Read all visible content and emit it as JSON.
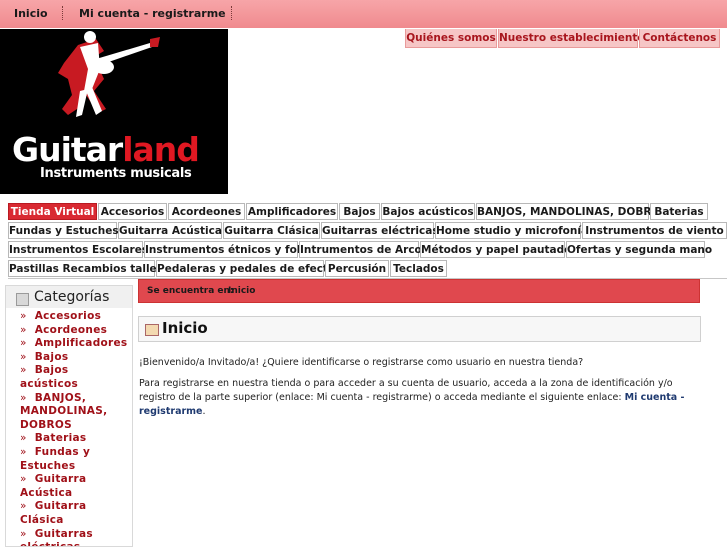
{
  "topnav": {
    "home": "Inicio",
    "account": "Mi cuenta - registrarme"
  },
  "toplinks": [
    "Quiénes somos",
    "Nuestro establecimiento",
    "Contáctenos"
  ],
  "logo": {
    "brand_a": "Guitar",
    "brand_b": "land",
    "tagline": "Instruments musicals"
  },
  "tabs": [
    "Tienda Virtual",
    "Accesorios",
    "Acordeones",
    "Amplificadores",
    "Bajos",
    "Bajos acústicos",
    "BANJOS, MANDOLINAS, DOBROS",
    "Baterias",
    "Fundas y Estuches",
    "Guitarra Acústica",
    "Guitarra Clásica",
    "Guitarras eléctricas",
    "Home studio y microfonía",
    "Instrumentos de viento",
    "Instrumentos Escolares",
    "Instrumentos étnicos y folk",
    "Intrumentos de Arco",
    "Métodos y papel pautado",
    "Ofertas y segunda mano",
    "Pastillas Recambios taller",
    "Pedaleras y pedales de efecto",
    "Percusión",
    "Teclados"
  ],
  "sidebar": {
    "title": "Categorías",
    "items": [
      "Accesorios",
      "Acordeones",
      "Amplificadores",
      "Bajos",
      "Bajos acústicos",
      "BANJOS, MANDOLINAS, DOBROS",
      "Baterias",
      "Fundas y Estuches",
      "Guitarra Acústica",
      "Guitarra Clásica",
      "Guitarras eléctricas"
    ]
  },
  "breadcrumb": {
    "label": "Se encuentra en:",
    "current": "Inicio"
  },
  "main": {
    "title": "Inicio",
    "welcome": "¡Bienvenido/a Invitado/a! ¿Quiere identificarse o registrarse como usuario en nuestra tienda?",
    "register_text": "Para registrarse en nuestra tienda o para acceder a su cuenta de usuario, acceda a la zona de identificación y/o registro de la parte superior (enlace: Mi cuenta - registrarme) o acceda mediante el siguiente enlace:",
    "register_link": "Mi cuenta - registrarme",
    "register_end": "."
  }
}
